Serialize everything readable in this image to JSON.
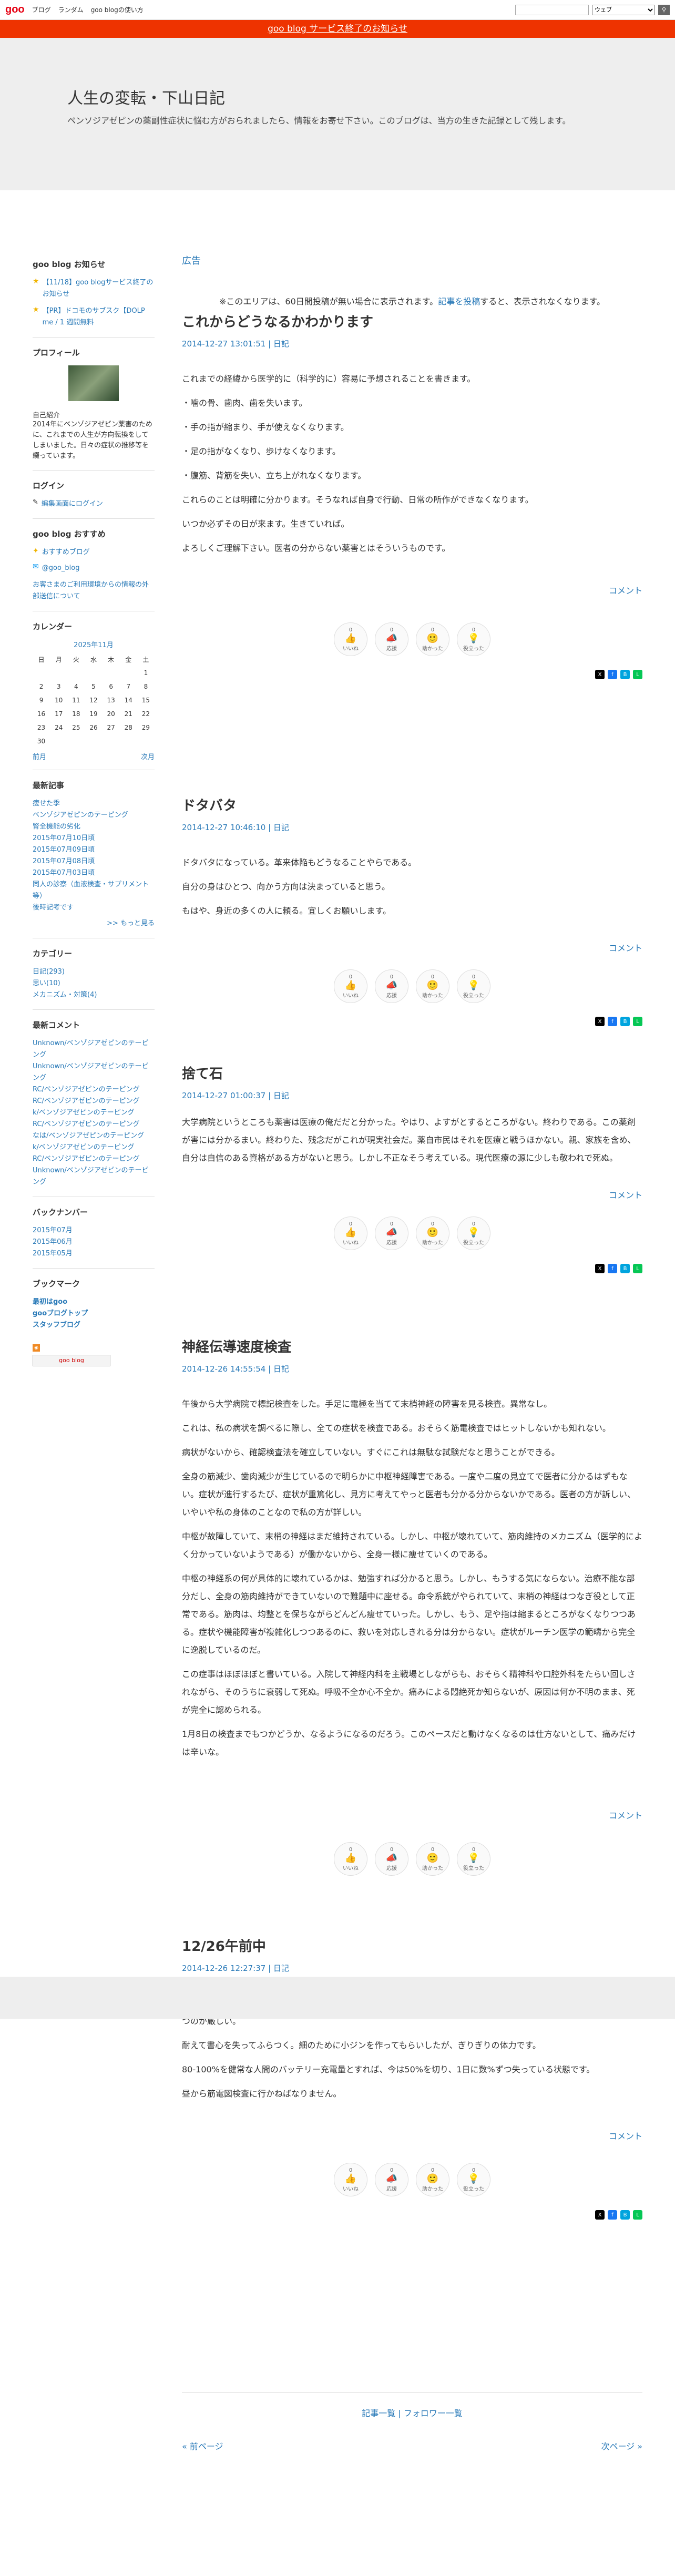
{
  "topbar": {
    "logo": "goo",
    "links": [
      "ブログ",
      "ランダム",
      "goo blogの使い方"
    ],
    "search_select": "ウェブ",
    "search_placeholder": ""
  },
  "notice": "goo blog サービス終了のお知らせ",
  "header": {
    "title": "人生の変転・下山日記",
    "desc": "ペンソジアゼピンの薬副性症状に悩む方がおられましたら、情報をお寄せ下さい。このブログは、当方の生きた記録として残します。"
  },
  "sidebar": {
    "news_title": "goo blog お知らせ",
    "news_items": [
      "【11/18】goo blogサービス終了のお知らせ",
      "【PR】ドコモのサブスク【DOLP me / 1 週間無料"
    ],
    "profile_title": "プロフィール",
    "profile_label": "自己紹介",
    "profile_text": "2014年にベンゾジアゼピン薬害のために、これまでの人生が方向転換をしてしまいました。日々の症状の推移等を綴っています。",
    "login_title": "ログイン",
    "login_link": "編集画面にログイン",
    "rec_title": "goo blog おすすめ",
    "rec_items": [
      "おすすめブログ",
      "@goo_blog",
      "お客さまのご利用環境からの情報の外部送信について"
    ],
    "cal_title": "カレンダー",
    "cal_month": "2025年11月",
    "cal_days": [
      "日",
      "月",
      "火",
      "水",
      "木",
      "金",
      "土"
    ],
    "cal_weeks": [
      [
        "",
        "",
        "",
        "",
        "",
        "",
        "1"
      ],
      [
        "2",
        "3",
        "4",
        "5",
        "6",
        "7",
        "8"
      ],
      [
        "9",
        "10",
        "11",
        "12",
        "13",
        "14",
        "15"
      ],
      [
        "16",
        "17",
        "18",
        "19",
        "20",
        "21",
        "22"
      ],
      [
        "23",
        "24",
        "25",
        "26",
        "27",
        "28",
        "29"
      ],
      [
        "30",
        "",
        "",
        "",
        "",
        "",
        ""
      ]
    ],
    "cal_prev": "前月",
    "cal_next": "次月",
    "recent_title": "最新記事",
    "recent_items": [
      "痩せた季",
      "ベンゾジアゼピンのテーピング",
      "腎全機能の劣化",
      "2015年07月10日頃",
      "2015年07月09日頃",
      "2015年07月08日頃",
      "2015年07月03日頃",
      "同人の診察（血液検査・サプリメント等）",
      "後時記考です"
    ],
    "recent_more": ">> もっと見る",
    "cat_title": "カテゴリー",
    "cat_items": [
      "日記(293)",
      "思い(10)",
      "メカニズム・対策(4)"
    ],
    "comment_title": "最新コメント",
    "comment_items": [
      "Unknown/ベンゾジアゼピンのテーピング",
      "Unknown/ベンゾジアゼピンのテーピング",
      "RC/ベンゾジアゼピンのテーピング",
      "RC/ベンゾジアゼピンのテーピング",
      "k/ベンゾジアゼピンのテーピング",
      "RC/ベンゾジアゼピンのテーピング",
      "なは/ベンゾジアゼピンのテーピング",
      "k/ベンゾジアゼピンのテーピング",
      "RC/ベンゾジアゼピンのテーピング",
      "Unknown/ベンゾジアゼピンのテーピング"
    ],
    "backnum_title": "バックナンバー",
    "backnum_items": [
      "2015年07月",
      "2015年06月",
      "2015年05月"
    ],
    "bookmark_title": "ブックマーク",
    "bookmark_items": [
      "最初はgoo",
      "gooブログトップ",
      "スタッフブログ"
    ],
    "badge": "goo blog"
  },
  "main": {
    "ad_label": "広告",
    "ad_note_pre": "※このエリアは、60日間投稿が無い場合に表示されます。",
    "ad_note_link": "記事を投稿",
    "ad_note_post": "すると、表示されなくなります。",
    "posts": [
      {
        "title": "これからどうなるかわかります",
        "date": "2014-12-27 13:01:51 | 日記",
        "paras": [
          "これまでの経緯から医学的に（科学的に）容易に予想されることを書きます。",
          "・噛の骨、歯肉、歯を失います。",
          "・手の指が縮まり、手が使えなくなります。",
          "・足の指がなくなり、歩けなくなります。",
          "・腹筋、背筋を失い、立ち上がれなくなります。",
          "これらのことは明確に分かります。そうなれば自身で行動、日常の所作ができなくなります。",
          "いつか必ずその日が来ます。生きていれば。",
          "よろしくご理解下さい。医者の分からない薬害とはそういうものです。"
        ]
      },
      {
        "title": "ドタバタ",
        "date": "2014-12-27 10:46:10 | 日記",
        "paras": [
          "ドタバタになっている。革来体陥もどうなることやらである。",
          "自分の身はひとつ、向かう方向は決まっていると思う。",
          "もはや、身近の多くの人に頼る。宜しくお願いします。"
        ]
      },
      {
        "title": "捨て石",
        "date": "2014-12-27 01:00:37 | 日記",
        "paras": [
          "大学病院というところも薬害は医療の俺だだと分かった。やはり、よすがとするところがない。終わりである。この薬剤が害には分かるまい。終わりた、残念だがこれが現実社会だ。薬自市民はそれを医療と戦うほかない。親、家族を含め、自分は自信のある資格がある方がないと思う。しかし不正なそう考えている。現代医療の源に少しも敬われで死ぬ。"
        ]
      },
      {
        "title": "神経伝導速度検査",
        "date": "2014-12-26 14:55:54 | 日記",
        "paras": [
          "午後から大学病院で標記検査をした。手足に電極を当てて末梢神経の障害を見る検査。異常なし。",
          "これは、私の病状を調べるに際し、全ての症状を検査である。おそらく筋電検査ではヒットしないかも知れない。",
          "病状がないから、確認検査法を確立していない。すぐにこれは無駄な試験だなと思うことができる。",
          "全身の筋減少、歯肉減少が生じているので明らかに中枢神経障害である。一度や二度の見立てで医者に分かるはずもない。症状が進行するたび、症状が重篤化し、見方に考えてやっと医者も分かる分からないかである。医者の方が訴しい、いやいや私の身体のことなので私の方が詳しい。",
          "中枢が故障していて、末梢の神経はまだ維持されている。しかし、中枢が壊れていて、筋肉維持のメカニズム（医学的によく分かっていないようである）が働かないから、全身一様に痩せていくのである。",
          "中枢の神経系の何が具体的に壊れているかは、勉強すれば分かると思う。しかし、もうする気にならない。治療不能な部分だし、全身の筋肉維持ができていないので難題中に座せる。命令系統がやられていて、末梢の神経はつなぎ役として正常である。筋肉は、均整とを保ちながらどんどん痩せていった。しかし、もう、足や指は縮まるところがなくなりつつある。症状や機能障害が複雑化しつつあるのに、救いを対応しきれる分は分からない。症状がルーチン医学の範疇から完全に逸脱しているのだ。",
          "この症事はほぼほぼと書いている。入院して神経内科を主戦場としながらも、おそらく精神科や口腔外科をたらい回しされながら、そのうちに衰弱して死ぬ。呼吸不全か心不全か。痛みによる悶絶死か知らないが、原因は何か不明のまま、死が完全に認められる。",
          "1月8日の検査までもつかどうか、なるようになるのだろう。このペースだと動けなくなるのは仕方ないとして、痛みだけは辛いな。"
        ]
      },
      {
        "title": "12/26午前中",
        "date": "2014-12-26 12:27:37 | 日記",
        "paras": [
          "入寮し指が使えない状態で午前中、家事をいくつかこなしましたが、もうそろそろできなくなりそうです。手でものを持つのが厳しい。",
          "耐えて書心を失ってふらつく。細のために小ジンを作ってもらいしたが、ぎりぎりの体力です。",
          "80-100%を健常な人間のバッテリー充電量とすれば、今は50%を切り、1日に数%ずつ失っている状態です。",
          "昼から筋電図検査に行かねばなりません。"
        ]
      }
    ],
    "comment_label": "コメント",
    "reactions": [
      {
        "count": "0",
        "label": "いいね"
      },
      {
        "count": "0",
        "label": "応援"
      },
      {
        "count": "0",
        "label": "助かった"
      },
      {
        "count": "0",
        "label": "役立った"
      }
    ],
    "footer_links": "記事一覧 | フォロワー一覧",
    "prev": "« 前ページ",
    "next": "次ページ »"
  }
}
